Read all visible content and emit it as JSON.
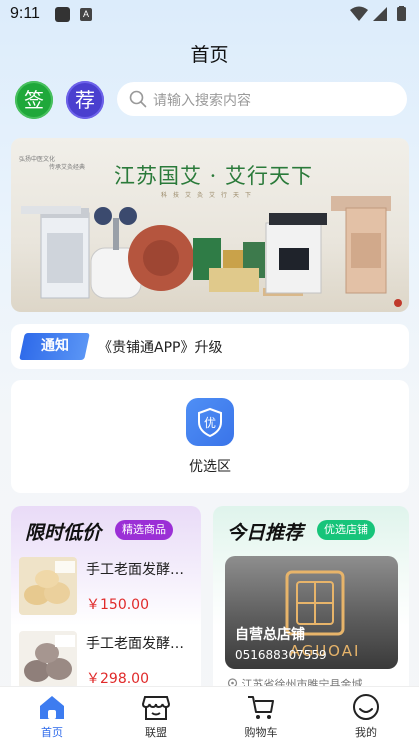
{
  "status_bar": {
    "time": "9:11",
    "notification_badge": "A"
  },
  "header": {
    "title": "首页"
  },
  "quick_buttons": {
    "sign_label": "签",
    "recommend_label": "荐"
  },
  "search": {
    "placeholder": "请输入搜索内容"
  },
  "banner": {
    "title": "江苏国艾 · 艾行天下",
    "subtitle": "科技艾灸艾行天下",
    "corner_text": [
      "弘扬中医文化",
      "传承艾灸经典"
    ]
  },
  "notice": {
    "tag": "通知",
    "text": "《贵铺通APP》升级"
  },
  "zone": {
    "icon_glyph": "优",
    "label": "优选区"
  },
  "flash_sale": {
    "title": "限时低价",
    "tag": "精选商品",
    "products": [
      {
        "name": "手工老面发酵馒头",
        "price": "￥150.00"
      },
      {
        "name": "手工老面发酵馒头",
        "price": "￥298.00"
      }
    ]
  },
  "today_pick": {
    "title": "今日推荐",
    "tag": "优选店铺",
    "shop": {
      "name": "自营总店铺",
      "phone": "051688307559",
      "logo_text": "AGUOAI",
      "address": "江苏省徐州市睢宁县金城"
    }
  },
  "tabbar": {
    "items": [
      {
        "label": "首页",
        "icon": "home-icon",
        "active": true
      },
      {
        "label": "联盟",
        "icon": "store-icon",
        "active": false
      },
      {
        "label": "购物车",
        "icon": "cart-icon",
        "active": false
      },
      {
        "label": "我的",
        "icon": "smile-icon",
        "active": false
      }
    ]
  },
  "colors": {
    "accent_blue": "#2f6bea",
    "price_red": "#e02a2a",
    "tag_purple": "#9b2fd6",
    "tag_green": "#17c47a",
    "sign_green": "#1fa83a",
    "recommend_purple": "#4a3fcf"
  }
}
